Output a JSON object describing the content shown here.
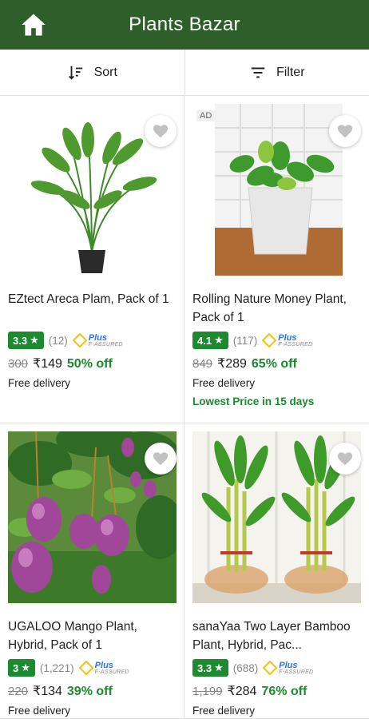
{
  "header": {
    "title": "Plants Bazar",
    "home_icon": "home-icon"
  },
  "toolbar": {
    "sort_label": "Sort",
    "filter_label": "Filter"
  },
  "badge": {
    "plus": "Plus",
    "assured": "F-ASSURED"
  },
  "products": [
    {
      "name": "EZtect Areca Plam, Pack of 1",
      "rating": "3.3",
      "count": "(12)",
      "mrp": "300",
      "price": "₹149",
      "off": "50% off",
      "delivery": "Free delivery",
      "ad": "",
      "note": ""
    },
    {
      "name": "Rolling Nature Money Plant, Pack of 1",
      "rating": "4.1",
      "count": "(117)",
      "mrp": "849",
      "price": "₹289",
      "off": "65% off",
      "delivery": "Free delivery",
      "ad": "AD",
      "note": "Lowest Price in 15 days"
    },
    {
      "name": "UGALOO Mango Plant, Hybrid, Pack of 1",
      "rating": "3",
      "count": "(1,221)",
      "mrp": "220",
      "price": "₹134",
      "off": "39% off",
      "delivery": "Free delivery",
      "ad": "",
      "note": ""
    },
    {
      "name": "sanaYaa Two Layer Bamboo Plant, Hybrid, Pac...",
      "rating": "3.3",
      "count": "(688)",
      "mrp": "1,199",
      "price": "₹284",
      "off": "76% off",
      "delivery": "Free delivery",
      "ad": "",
      "note": ""
    }
  ],
  "colors": {
    "appbar": "#2e5e2a",
    "rating": "#1c8a2e",
    "plus": "#2874f0"
  }
}
